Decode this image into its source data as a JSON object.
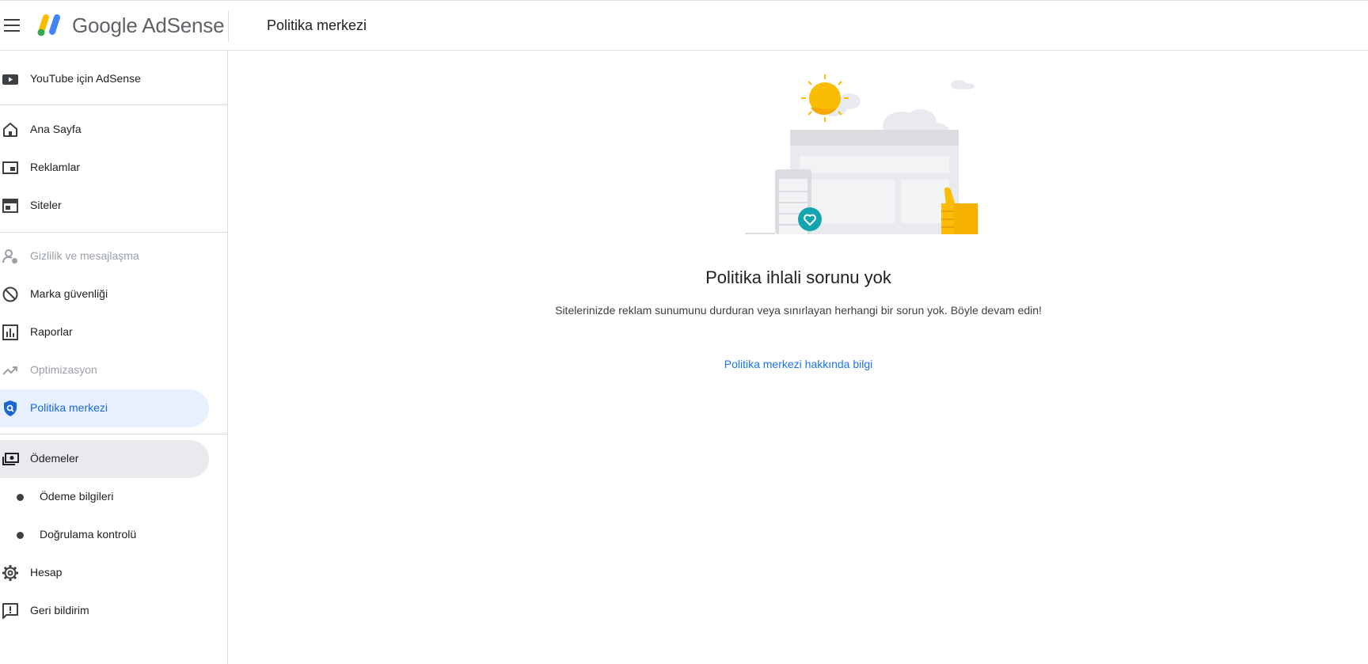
{
  "header": {
    "brand_google": "Google",
    "brand_product": "AdSense",
    "page_title": "Politika merkezi"
  },
  "sidebar": {
    "items": [
      {
        "label": "YouTube için AdSense",
        "icon": "youtube-icon",
        "state": "normal"
      },
      {
        "label": "Ana Sayfa",
        "icon": "home-icon",
        "state": "normal"
      },
      {
        "label": "Reklamlar",
        "icon": "ads-icon",
        "state": "normal"
      },
      {
        "label": "Siteler",
        "icon": "sites-icon",
        "state": "normal"
      },
      {
        "label": "Gizlilik ve mesajlaşma",
        "icon": "privacy-icon",
        "state": "disabled"
      },
      {
        "label": "Marka güvenliği",
        "icon": "block-icon",
        "state": "normal"
      },
      {
        "label": "Raporlar",
        "icon": "bar-chart-icon",
        "state": "normal"
      },
      {
        "label": "Optimizasyon",
        "icon": "trending-up-icon",
        "state": "disabled"
      },
      {
        "label": "Politika merkezi",
        "icon": "policy-shield-icon",
        "state": "active"
      },
      {
        "label": "Ödemeler",
        "icon": "payments-icon",
        "state": "selected"
      },
      {
        "label": "Ödeme bilgileri",
        "icon": "bullet-icon",
        "state": "sub"
      },
      {
        "label": "Doğrulama kontrolü",
        "icon": "bullet-icon",
        "state": "sub"
      },
      {
        "label": "Hesap",
        "icon": "gear-icon",
        "state": "normal"
      },
      {
        "label": "Geri bildirim",
        "icon": "feedback-icon",
        "state": "normal"
      }
    ]
  },
  "main": {
    "title": "Politika ihlali sorunu yok",
    "subtitle": "Sitelerinizde reklam sunumunu durduran veya sınırlayan herhangi bir sorun yok. Böyle devam edin!",
    "link": "Politika merkezi hakkında bilgi"
  },
  "colors": {
    "accent": "#1a73e8",
    "active_bg": "#e8f0fe",
    "selected_bg": "#e8eaed",
    "disabled_text": "#9aa0a6",
    "sun": "#fbbc04",
    "teal_badge": "#12a4af"
  }
}
